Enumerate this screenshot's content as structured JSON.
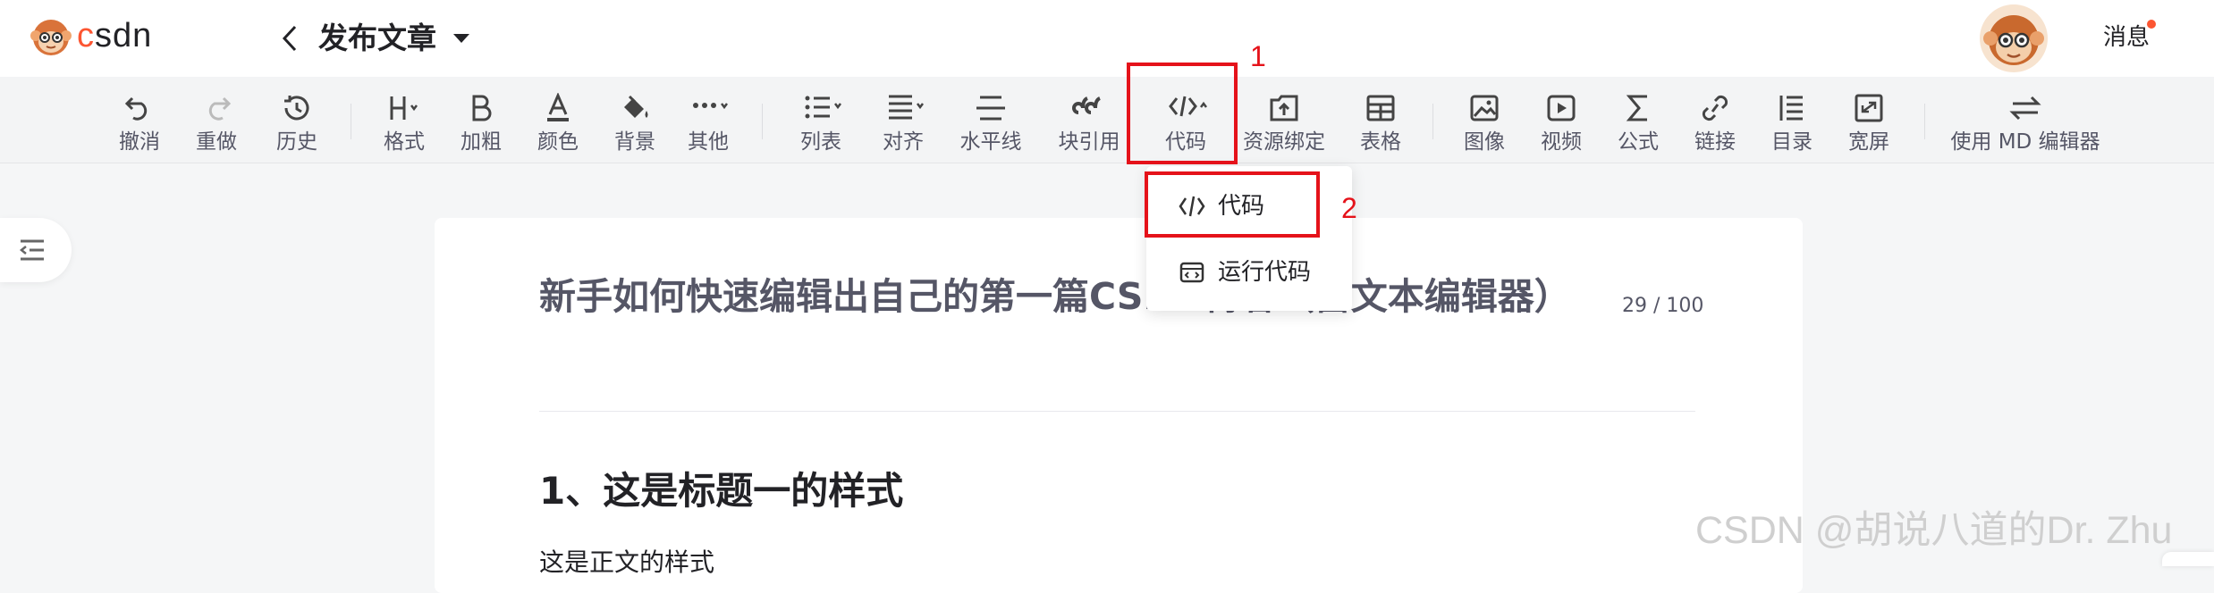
{
  "header": {
    "logo_text": "csdn",
    "title": "发布文章",
    "messages_label": "消息"
  },
  "toolbar": {
    "items": [
      {
        "label": "撤消",
        "icon": "undo-icon"
      },
      {
        "label": "重做",
        "icon": "redo-icon"
      },
      {
        "label": "历史",
        "icon": "history-icon"
      },
      {
        "label": "格式",
        "icon": "heading-icon"
      },
      {
        "label": "加粗",
        "icon": "bold-icon"
      },
      {
        "label": "颜色",
        "icon": "font-color-icon"
      },
      {
        "label": "背景",
        "icon": "paint-bucket-icon"
      },
      {
        "label": "其他",
        "icon": "more-icon"
      },
      {
        "label": "列表",
        "icon": "list-icon"
      },
      {
        "label": "对齐",
        "icon": "align-icon"
      },
      {
        "label": "水平线",
        "icon": "horizontal-line-icon"
      },
      {
        "label": "块引用",
        "icon": "quote-icon"
      },
      {
        "label": "代码",
        "icon": "code-icon"
      },
      {
        "label": "资源绑定",
        "icon": "resource-upload-icon"
      },
      {
        "label": "表格",
        "icon": "table-icon"
      },
      {
        "label": "图像",
        "icon": "image-icon"
      },
      {
        "label": "视频",
        "icon": "video-icon"
      },
      {
        "label": "公式",
        "icon": "sigma-icon"
      },
      {
        "label": "链接",
        "icon": "link-icon"
      },
      {
        "label": "目录",
        "icon": "toc-icon"
      },
      {
        "label": "宽屏",
        "icon": "widescreen-icon"
      },
      {
        "label": "使用 MD 编辑器",
        "icon": "switch-arrows-icon"
      }
    ]
  },
  "annotations": {
    "tag1": "1",
    "tag2": "2",
    "color": "#e5121a"
  },
  "dropdown": {
    "items": [
      {
        "label": "代码",
        "icon": "code-icon"
      },
      {
        "label": "运行代码",
        "icon": "run-code-icon"
      }
    ]
  },
  "editor": {
    "title": "新手如何快速编辑出自己的第一篇CSDN博客（富文本编辑器）",
    "counter": "29 / 100",
    "heading1": "1、这是标题一的样式",
    "paragraph": "这是正文的样式"
  },
  "watermark": "CSDN @胡说八道的Dr. Zhu",
  "colors": {
    "brand": "#fc5531",
    "toolbar_bg": "#f3f4f5",
    "page_bg": "#f5f6f7"
  }
}
